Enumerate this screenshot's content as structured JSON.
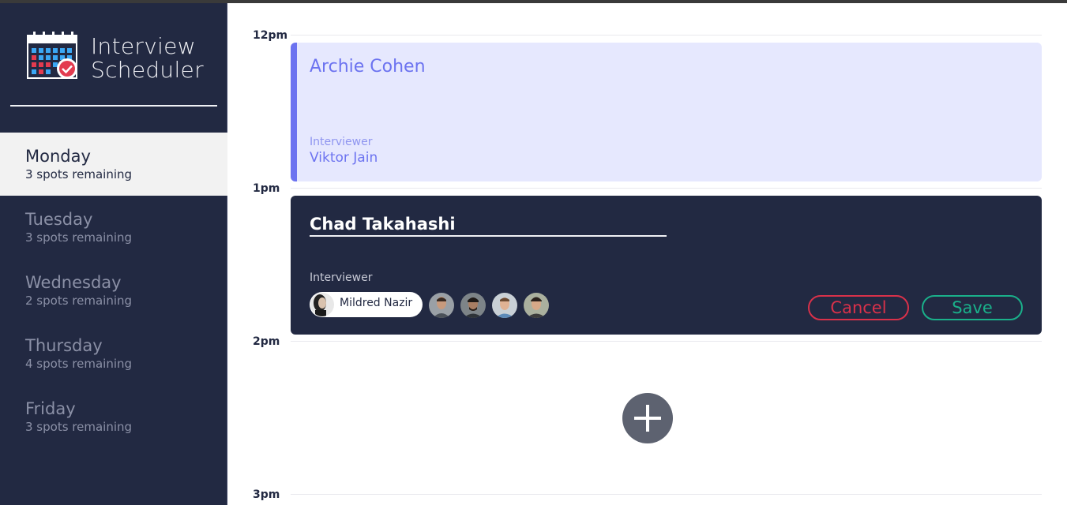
{
  "app": {
    "title_line1": "Interview",
    "title_line2": "Scheduler"
  },
  "sidebar": {
    "days": [
      {
        "name": "Monday",
        "spots": "3 spots remaining",
        "selected": true
      },
      {
        "name": "Tuesday",
        "spots": "3 spots remaining",
        "selected": false
      },
      {
        "name": "Wednesday",
        "spots": "2 spots remaining",
        "selected": false
      },
      {
        "name": "Thursday",
        "spots": "4 spots remaining",
        "selected": false
      },
      {
        "name": "Friday",
        "spots": "3 spots remaining",
        "selected": false
      }
    ]
  },
  "schedule": {
    "times": [
      "12pm",
      "1pm",
      "2pm",
      "3pm"
    ],
    "booked": {
      "student": "Archie Cohen",
      "interviewer_label": "Interviewer",
      "interviewer": "Viktor Jain"
    },
    "form": {
      "student_value": "Chad Takahashi",
      "interviewer_label": "Interviewer",
      "selected_interviewer": "Mildred Nazir",
      "cancel_label": "Cancel",
      "save_label": "Save"
    }
  },
  "colors": {
    "sidebar": "#222942",
    "accent": "#6c73f0",
    "cancel": "#d9314a",
    "save": "#1ab08a"
  },
  "icons": {
    "logo": "calendar-check-icon",
    "add": "plus-icon"
  }
}
